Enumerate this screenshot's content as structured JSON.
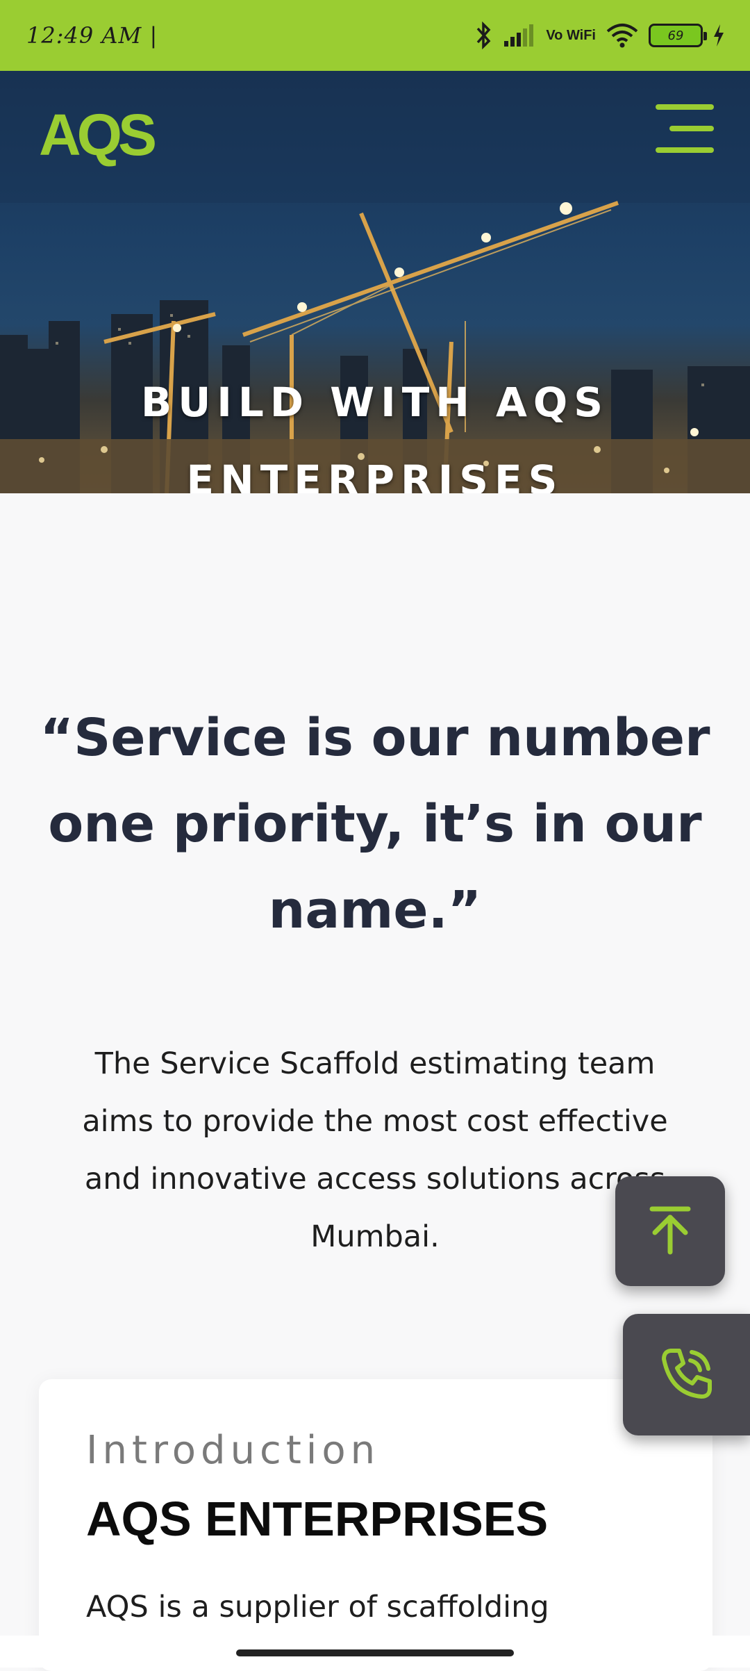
{
  "status_bar": {
    "time": "12:49 AM |",
    "network": "Vo WiFi",
    "battery": "69",
    "icons": [
      "bluetooth-icon",
      "signal-icon",
      "wifi-icon",
      "battery-icon",
      "charging-icon"
    ]
  },
  "header": {
    "logo": "AQS",
    "menu_icon": "hamburger-menu-icon"
  },
  "hero": {
    "title_line1": "BUILD WITH AQS",
    "title_line2": "ENTERPRISES"
  },
  "quote": {
    "line1": "“Service is our number",
    "line2": "one priority, it’s in our",
    "line3": "name.”"
  },
  "intro_text": {
    "line1": "The Service Scaffold estimating team",
    "line2": "aims to provide the most cost effective",
    "line3": "and innovative access solutions across",
    "line4": "Mumbai."
  },
  "card": {
    "eyebrow": "Introduction",
    "title": "AQS ENTERPRISES",
    "body_start": "AQS is a supplier of scaffolding"
  },
  "fabs": {
    "scroll_top_icon": "arrow-up-to-top-icon",
    "call_icon": "phone-call-icon"
  },
  "colors": {
    "brand_green": "#9acd32",
    "dark_navy": "#252b3d",
    "fab_gray": "#4a4950"
  }
}
